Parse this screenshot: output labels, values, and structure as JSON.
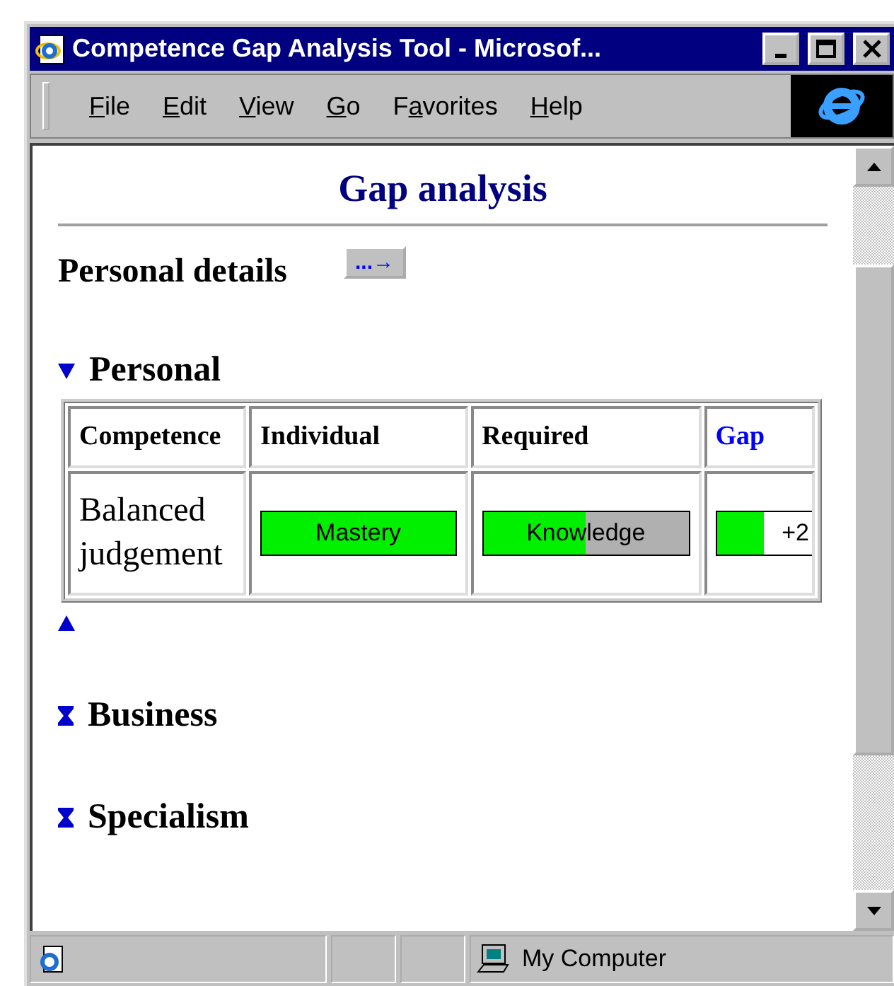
{
  "window": {
    "title": "Competence Gap Analysis Tool - Microsof..."
  },
  "menu": [
    {
      "access_key": "F",
      "after": "ile"
    },
    {
      "access_key": "E",
      "after": "dit"
    },
    {
      "access_key": "V",
      "after": "iew"
    },
    {
      "access_key": "G",
      "after": "o"
    },
    {
      "before": "F",
      "access_key": "a",
      "after": "vorites"
    },
    {
      "access_key": "H",
      "after": "elp"
    }
  ],
  "page": {
    "heading": "Gap analysis",
    "personal_details": {
      "label": "Personal details",
      "button": "...→"
    },
    "sections": [
      {
        "title": "Personal",
        "expanded": true,
        "table": {
          "columns": [
            {
              "label": "Competence",
              "kind": "text"
            },
            {
              "label": "Individual",
              "kind": "text"
            },
            {
              "label": "Required",
              "kind": "text"
            },
            {
              "label": "Gap",
              "kind": "link"
            }
          ],
          "rows": [
            {
              "competence": "Balanced judgement",
              "individual": {
                "label": "Mastery",
                "level": 1
              },
              "required": {
                "label": "Knowledge",
                "level": 0.5
              },
              "gap": {
                "label": "+2",
                "level": 0.5
              }
            }
          ]
        }
      },
      {
        "title": "Business",
        "expanded": false
      },
      {
        "title": "Specialism",
        "expanded": false
      }
    ]
  },
  "status_bar": {
    "zone": "My Computer"
  }
}
